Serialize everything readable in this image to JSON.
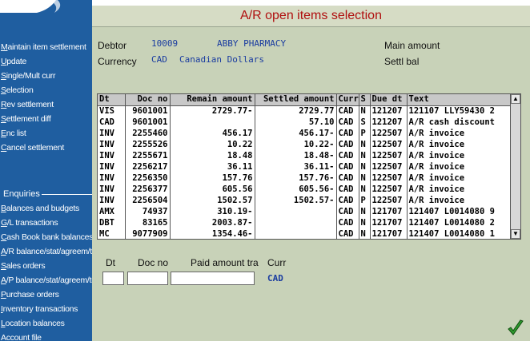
{
  "window": {
    "title": "A/R open items selection"
  },
  "sidebar": {
    "items": [
      {
        "accel": "M",
        "rest": "aintain item settlement"
      },
      {
        "accel": "U",
        "rest": "pdate"
      },
      {
        "accel": "S",
        "rest": "ingle/Mult curr"
      },
      {
        "accel": "S",
        "rest": "election"
      },
      {
        "accel": "R",
        "rest": "ev settlement"
      },
      {
        "accel": "S",
        "rest": "ettlement diff"
      },
      {
        "accel": "E",
        "rest": "nc list"
      },
      {
        "accel": "C",
        "rest": "ancel settlement"
      }
    ],
    "enquiries_title": "Enquiries",
    "enquiries": [
      {
        "accel": "B",
        "rest": "alances and budgets"
      },
      {
        "accel": "G",
        "rest": "/L transactions"
      },
      {
        "accel": "C",
        "rest": "ash Book bank balances"
      },
      {
        "accel": "A",
        "rest": "/R balance/stat/agreem/trar"
      },
      {
        "accel": "S",
        "rest": "ales orders"
      },
      {
        "accel": "A",
        "rest": "/P balance/stat/agreem/trar"
      },
      {
        "accel": "P",
        "rest": "urchase orders"
      },
      {
        "accel": "I",
        "rest": "nventory transactions"
      },
      {
        "accel": "L",
        "rest": "ocation balances"
      },
      {
        "accel": "A",
        "rest": "ccount file"
      }
    ]
  },
  "header": {
    "debtor_label": "Debtor",
    "debtor_code": "10009",
    "debtor_name": "ABBY PHARMACY",
    "currency_label": "Currency",
    "currency_code": "CAD",
    "currency_name": "Canadian Dollars",
    "main_amount_label": "Main amount",
    "settl_bal_label": "Settl bal"
  },
  "grid": {
    "columns": [
      "Dt",
      "Doc no",
      "Remain amount",
      "Settled amount",
      "Curr",
      "S",
      "Due dt",
      "Text"
    ],
    "rows": [
      [
        "VIS",
        "9601001",
        "2729.77-",
        "2729.77",
        "CAD",
        "N",
        "121207",
        "121107 LLY59430 2"
      ],
      [
        "CAD",
        "9601001",
        "",
        "57.10",
        "CAD",
        "S",
        "121207",
        "A/R cash discount"
      ],
      [
        "INV",
        "2255460",
        "456.17",
        "456.17-",
        "CAD",
        "P",
        "122507",
        "A/R invoice"
      ],
      [
        "INV",
        "2255526",
        "10.22",
        "10.22-",
        "CAD",
        "N",
        "122507",
        "A/R invoice"
      ],
      [
        "INV",
        "2255671",
        "18.48",
        "18.48-",
        "CAD",
        "N",
        "122507",
        "A/R invoice"
      ],
      [
        "INV",
        "2256217",
        "36.11",
        "36.11-",
        "CAD",
        "N",
        "122507",
        "A/R invoice"
      ],
      [
        "INV",
        "2256350",
        "157.76",
        "157.76-",
        "CAD",
        "N",
        "122507",
        "A/R invoice"
      ],
      [
        "INV",
        "2256377",
        "605.56",
        "605.56-",
        "CAD",
        "N",
        "122507",
        "A/R invoice"
      ],
      [
        "INV",
        "2256504",
        "1502.57",
        "1502.57-",
        "CAD",
        "P",
        "122507",
        "A/R invoice"
      ],
      [
        "AMX",
        "74937",
        "310.19-",
        "",
        "CAD",
        "N",
        "121707",
        "121407 L0014080 9"
      ],
      [
        "DBT",
        "83165",
        "2003.87-",
        "",
        "CAD",
        "N",
        "121707",
        "121407 L0014080 2"
      ],
      [
        "MC",
        "9077909",
        "1354.46-",
        "",
        "CAD",
        "N",
        "121707",
        "121407 L0014080 1"
      ]
    ]
  },
  "entry": {
    "dt_label": "Dt",
    "doc_no_label": "Doc no",
    "paid_amount_label": "Paid amount tra",
    "curr_label": "Curr",
    "curr_value": "CAD"
  },
  "colors": {
    "sidebar": "#1f5ea0",
    "title": "#b01010",
    "value": "#1a3ca0",
    "background": "#c8d2b8"
  },
  "icons": {
    "ok": "checkmark-icon",
    "scroll_up": "arrow-up-icon",
    "scroll_down": "arrow-down-icon"
  }
}
